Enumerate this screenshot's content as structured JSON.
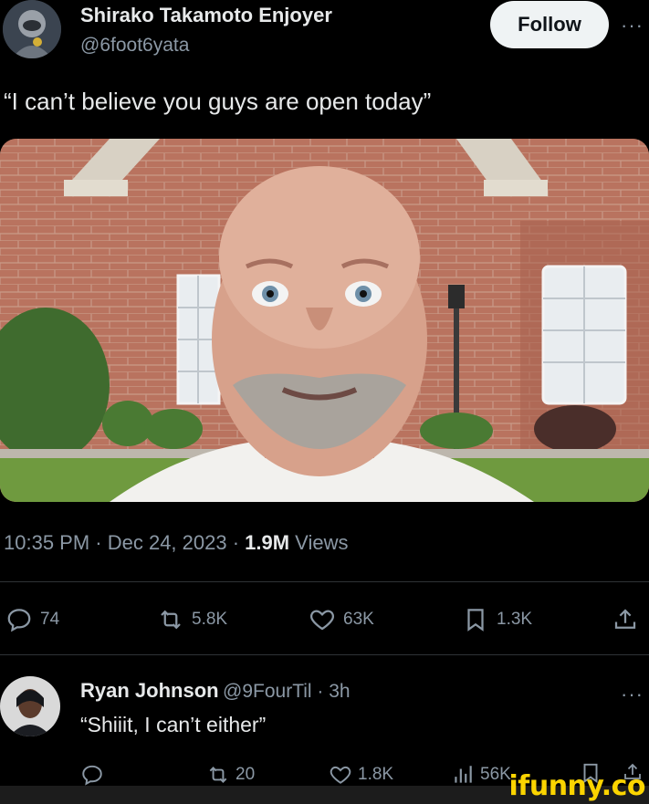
{
  "tweet": {
    "author_name": "Shirako Takamoto Enjoyer",
    "author_handle": "@6foot6yata",
    "follow_label": "Follow",
    "more_label": "···",
    "text": "“I can’t believe you guys are open today”",
    "time": "10:35 PM · Dec 24, 2023 · ",
    "views_count": "1.9M",
    "views_label": " Views"
  },
  "actions": {
    "replies": "74",
    "retweets": "5.8K",
    "likes": "63K",
    "bookmarks": "1.3K"
  },
  "reply": {
    "name": "Ryan Johnson",
    "handle_time": "@9FourTil · 3h",
    "text": "“Shiiit, I can’t either”",
    "more_label": "···",
    "retweets": "20",
    "likes": "1.8K",
    "views": "56K"
  },
  "watermark": "ifunny.co",
  "colors": {
    "background": "#000000",
    "text": "#e7e9ea",
    "muted": "#8b98a5",
    "divider": "#2f3336",
    "watermark": "#fbd400"
  }
}
